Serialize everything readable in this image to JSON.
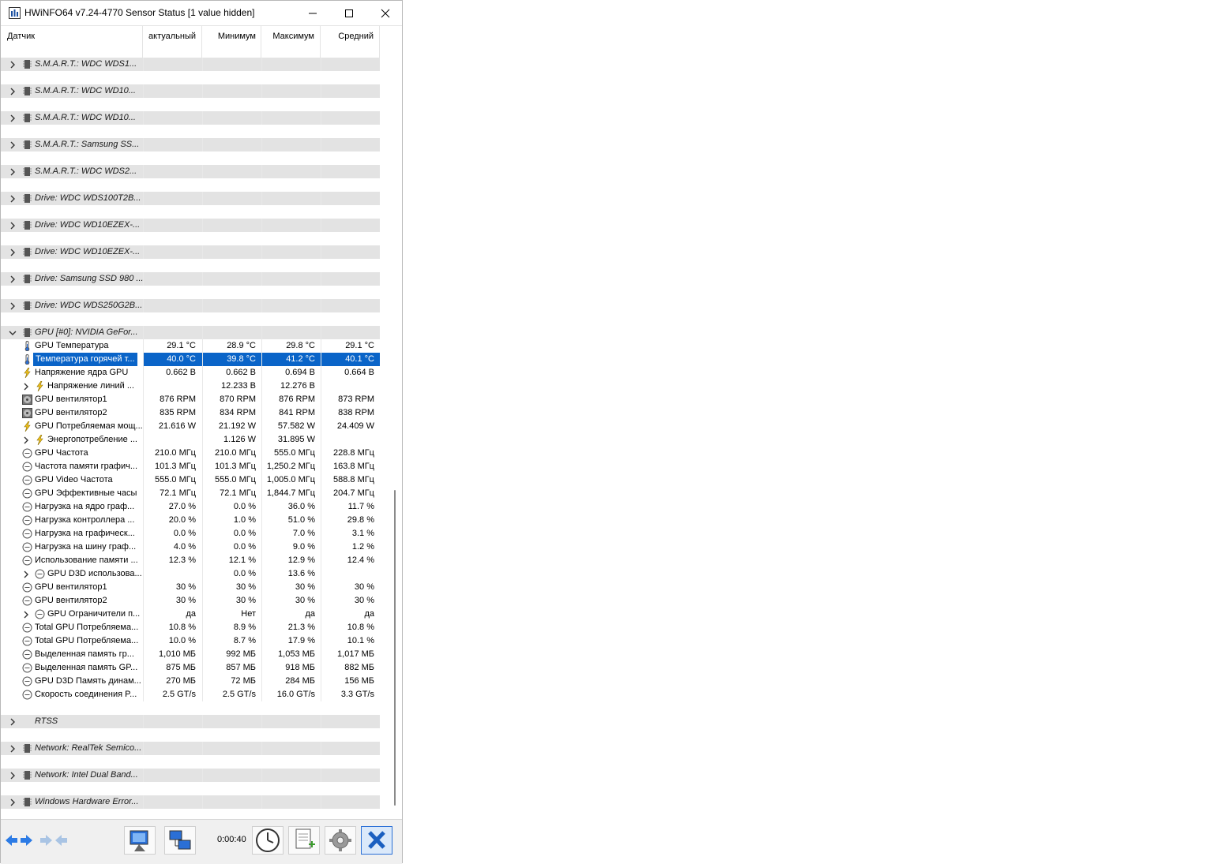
{
  "window": {
    "title": "HWiNFO64 v7.24-4770 Sensor Status [1 value hidden]"
  },
  "columns": {
    "sensor": "Датчик",
    "current": "актуальный",
    "min": "Минимум",
    "max": "Максимум",
    "avg": "Средний"
  },
  "groups_top": [
    {
      "label": "S.M.A.R.T.: WDC WDS1..."
    },
    {
      "label": "S.M.A.R.T.: WDC WD10..."
    },
    {
      "label": "S.M.A.R.T.: WDC WD10..."
    },
    {
      "label": "S.M.A.R.T.: Samsung SS..."
    },
    {
      "label": "S.M.A.R.T.: WDC WDS2..."
    },
    {
      "label": "Drive: WDC WDS100T2B..."
    },
    {
      "label": "Drive: WDC WD10EZEX-..."
    },
    {
      "label": "Drive: WDC WD10EZEX-..."
    },
    {
      "label": "Drive: Samsung SSD 980 ..."
    },
    {
      "label": "Drive: WDC WDS250G2B..."
    }
  ],
  "gpu_group": {
    "label": "GPU [#0]: NVIDIA GeFor..."
  },
  "gpu_rows": [
    {
      "label": "GPU Температура",
      "icon": "thermometer-icon",
      "cur": "29.1 °C",
      "min": "28.9 °C",
      "max": "29.8 °C",
      "avg": "29.1 °C"
    },
    {
      "label": "Температура горячей т...",
      "icon": "thermometer-icon",
      "cur": "40.0 °C",
      "min": "39.8 °C",
      "max": "41.2 °C",
      "avg": "40.1 °C",
      "selected": true
    },
    {
      "label": "Напряжение ядра GPU",
      "icon": "lightning-icon",
      "cur": "0.662 В",
      "min": "0.662 В",
      "max": "0.694 В",
      "avg": "0.664 В"
    },
    {
      "label": "Напряжение линий ...",
      "icon": "lightning-icon",
      "expandable": true,
      "cur": "",
      "min": "12.233 В",
      "max": "12.276 В",
      "avg": ""
    },
    {
      "label": "GPU вентилятор1",
      "icon": "fan-icon",
      "cur": "876 RPM",
      "min": "870 RPM",
      "max": "876 RPM",
      "avg": "873 RPM"
    },
    {
      "label": "GPU вентилятор2",
      "icon": "fan-icon",
      "cur": "835 RPM",
      "min": "834 RPM",
      "max": "841 RPM",
      "avg": "838 RPM"
    },
    {
      "label": "GPU Потребляемая мощ...",
      "icon": "lightning-icon",
      "cur": "21.616 W",
      "min": "21.192 W",
      "max": "57.582 W",
      "avg": "24.409 W"
    },
    {
      "label": "Энергопотребление ...",
      "icon": "lightning-icon",
      "expandable": true,
      "cur": "",
      "min": "1.126 W",
      "max": "31.895 W",
      "avg": ""
    },
    {
      "label": "GPU Частота",
      "icon": "clock-icon",
      "cur": "210.0 МГц",
      "min": "210.0 МГц",
      "max": "555.0 МГц",
      "avg": "228.8 МГц"
    },
    {
      "label": "Частота памяти графич...",
      "icon": "clock-icon",
      "cur": "101.3 МГц",
      "min": "101.3 МГц",
      "max": "1,250.2 МГц",
      "avg": "163.8 МГц"
    },
    {
      "label": "GPU Video Частота",
      "icon": "clock-icon",
      "cur": "555.0 МГц",
      "min": "555.0 МГц",
      "max": "1,005.0 МГц",
      "avg": "588.8 МГц"
    },
    {
      "label": "GPU Эффективные часы",
      "icon": "clock-icon",
      "cur": "72.1 МГц",
      "min": "72.1 МГц",
      "max": "1,844.7 МГц",
      "avg": "204.7 МГц"
    },
    {
      "label": "Нагрузка на ядро граф...",
      "icon": "clock-icon",
      "cur": "27.0 %",
      "min": "0.0 %",
      "max": "36.0 %",
      "avg": "11.7 %"
    },
    {
      "label": "Нагрузка контроллера ...",
      "icon": "clock-icon",
      "cur": "20.0 %",
      "min": "1.0 %",
      "max": "51.0 %",
      "avg": "29.8 %"
    },
    {
      "label": "Нагрузка на графическ...",
      "icon": "clock-icon",
      "cur": "0.0 %",
      "min": "0.0 %",
      "max": "7.0 %",
      "avg": "3.1 %"
    },
    {
      "label": "Нагрузка на шину граф...",
      "icon": "clock-icon",
      "cur": "4.0 %",
      "min": "0.0 %",
      "max": "9.0 %",
      "avg": "1.2 %"
    },
    {
      "label": "Использование памяти ...",
      "icon": "clock-icon",
      "cur": "12.3 %",
      "min": "12.1 %",
      "max": "12.9 %",
      "avg": "12.4 %"
    },
    {
      "label": "GPU D3D использова...",
      "icon": "clock-icon",
      "expandable": true,
      "cur": "",
      "min": "0.0 %",
      "max": "13.6 %",
      "avg": ""
    },
    {
      "label": "GPU вентилятор1",
      "icon": "clock-icon",
      "cur": "30 %",
      "min": "30 %",
      "max": "30 %",
      "avg": "30 %"
    },
    {
      "label": "GPU вентилятор2",
      "icon": "clock-icon",
      "cur": "30 %",
      "min": "30 %",
      "max": "30 %",
      "avg": "30 %"
    },
    {
      "label": "GPU Ограничители п...",
      "icon": "clock-icon",
      "expandable": true,
      "cur": "да",
      "min": "Нет",
      "max": "да",
      "avg": "да"
    },
    {
      "label": "Total GPU Потребляема...",
      "icon": "clock-icon",
      "cur": "10.8 %",
      "min": "8.9 %",
      "max": "21.3 %",
      "avg": "10.8 %"
    },
    {
      "label": "Total GPU Потребляема...",
      "icon": "clock-icon",
      "cur": "10.0 %",
      "min": "8.7 %",
      "max": "17.9 %",
      "avg": "10.1 %"
    },
    {
      "label": "Выделенная память гр...",
      "icon": "clock-icon",
      "cur": "1,010 МБ",
      "min": "992 МБ",
      "max": "1,053 МБ",
      "avg": "1,017 МБ"
    },
    {
      "label": "Выделенная память GP...",
      "icon": "clock-icon",
      "cur": "875 МБ",
      "min": "857 МБ",
      "max": "918 МБ",
      "avg": "882 МБ"
    },
    {
      "label": "GPU D3D Память динам...",
      "icon": "clock-icon",
      "cur": "270 МБ",
      "min": "72 МБ",
      "max": "284 МБ",
      "avg": "156 МБ"
    },
    {
      "label": "Скорость соединения P...",
      "icon": "clock-icon",
      "cur": "2.5 GT/s",
      "min": "2.5 GT/s",
      "max": "16.0 GT/s",
      "avg": "3.3 GT/s"
    }
  ],
  "groups_bottom": [
    {
      "label": "RTSS",
      "icon": "none"
    },
    {
      "label": "Network: RealTek Semico...",
      "icon": "chip-icon"
    },
    {
      "label": "Network: Intel Dual Band...",
      "icon": "chip-icon"
    },
    {
      "label": "Windows Hardware Error...",
      "icon": "chip-icon"
    }
  ],
  "toolbar": {
    "timer": "0:00:40"
  }
}
